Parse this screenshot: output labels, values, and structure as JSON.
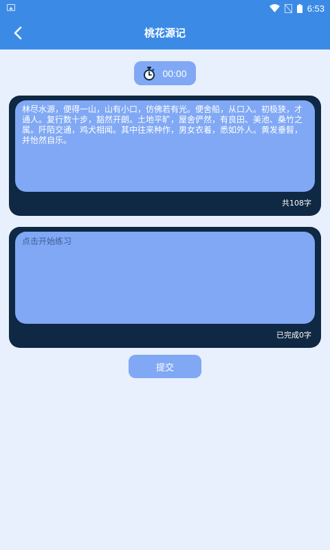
{
  "status_bar": {
    "time": "6:53",
    "icons": [
      "notification-icon",
      "wifi-icon",
      "signal-off-icon",
      "battery-icon"
    ]
  },
  "app_bar": {
    "title": "桃花源记",
    "back_icon": "chevron-left-icon"
  },
  "timer": {
    "icon": "stopwatch-icon",
    "value": "00:00"
  },
  "reference": {
    "text": "林尽水源，便得一山，山有小口，仿佛若有光。便舍船，从口入。初极狭，才通人。复行数十步，豁然开朗。土地平旷，屋舍俨然，有良田、美池、桑竹之属。阡陌交通，鸡犬相闻。其中往来种作，男女衣着，悉如外人。黄发垂髫，并怡然自乐。",
    "count_label": "共108字"
  },
  "practice": {
    "value": "",
    "placeholder": "点击开始练习",
    "count_label": "已完成0字"
  },
  "actions": {
    "submit_label": "提交"
  },
  "colors": {
    "primary": "#3b8be6",
    "background": "#e8f0fd",
    "panel": "#0f2843",
    "panel_inner": "#80a8f4",
    "button": "#80a8f4"
  }
}
